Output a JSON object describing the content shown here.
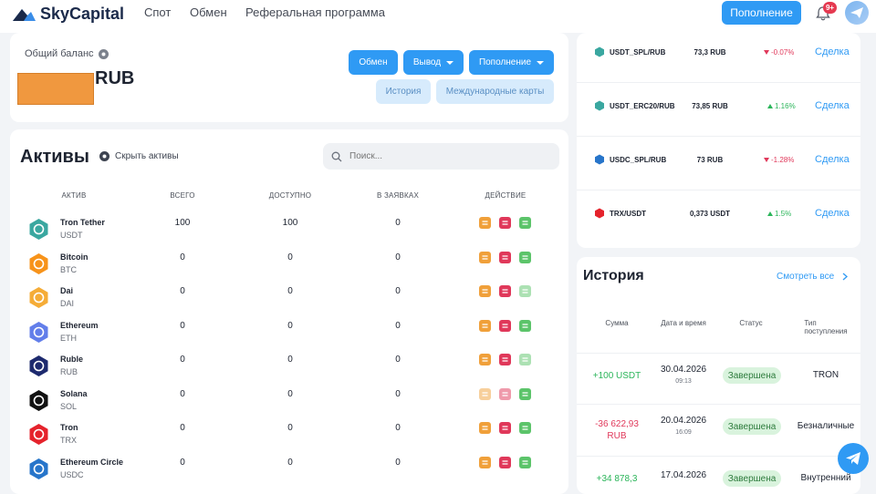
{
  "header": {
    "brand": "SkyCapital",
    "nav": [
      "Спот",
      "Обмен",
      "Реферальная программа"
    ],
    "topup_label": "Пополнение",
    "notifications_badge": "9+"
  },
  "balance": {
    "label": "Общий баланс",
    "currency": "RUB",
    "buttons": {
      "exchange": "Обмен",
      "withdraw": "Вывод",
      "topup": "Пополнение",
      "history": "История",
      "cards": "Международные карты"
    }
  },
  "assets": {
    "title": "Активы",
    "hide_label": "Скрыть активы",
    "search_placeholder": "Поиск...",
    "columns": [
      "АКТИВ",
      "ВСЕГО",
      "ДОСТУПНО",
      "В ЗАЯВКАХ",
      "ДЕЙСТВИЕ"
    ],
    "rows": [
      {
        "name": "Tron Tether",
        "ticker": "USDT",
        "total": "100",
        "available": "100",
        "orders": "0",
        "icon": "tether-icon",
        "color": "#3aa7a0"
      },
      {
        "name": "Bitcoin",
        "ticker": "BTC",
        "total": "0",
        "available": "0",
        "orders": "0",
        "icon": "bitcoin-icon",
        "color": "#f7931a"
      },
      {
        "name": "Dai",
        "ticker": "DAI",
        "total": "0",
        "available": "0",
        "orders": "0",
        "icon": "dai-icon",
        "color": "#f5ac37"
      },
      {
        "name": "Ethereum",
        "ticker": "ETH",
        "total": "0",
        "available": "0",
        "orders": "0",
        "icon": "ethereum-icon",
        "color": "#627eea"
      },
      {
        "name": "Ruble",
        "ticker": "RUB",
        "total": "0",
        "available": "0",
        "orders": "0",
        "icon": "ruble-icon",
        "color": "#1d2a6e"
      },
      {
        "name": "Solana",
        "ticker": "SOL",
        "total": "0",
        "available": "0",
        "orders": "0",
        "icon": "solana-icon",
        "color": "#111111"
      },
      {
        "name": "Tron",
        "ticker": "TRX",
        "total": "0",
        "available": "0",
        "orders": "0",
        "icon": "tron-icon",
        "color": "#e5232c"
      },
      {
        "name": "Ethereum Circle",
        "ticker": "USDC",
        "total": "0",
        "available": "0",
        "orders": "0",
        "icon": "usdc-icon",
        "color": "#2775ca"
      }
    ]
  },
  "pairs": [
    {
      "name": "USDT_SPL/RUB",
      "price": "73,3 RUB",
      "change": "-0.07%",
      "dir": "down",
      "deal": "Сделка",
      "icon_color": "#3aa7a0"
    },
    {
      "name": "USDT_ERC20/RUB",
      "price": "73,85 RUB",
      "change": "1.16%",
      "dir": "up",
      "deal": "Сделка",
      "icon_color": "#3aa7a0"
    },
    {
      "name": "USDC_SPL/RUB",
      "price": "73 RUB",
      "change": "-1.28%",
      "dir": "down",
      "deal": "Сделка",
      "icon_color": "#2775ca"
    },
    {
      "name": "TRX/USDT",
      "price": "0,373 USDT",
      "change": "1.5%",
      "dir": "up",
      "deal": "Сделка",
      "icon_color": "#e5232c"
    }
  ],
  "history": {
    "title": "История",
    "see_all": "Смотреть все",
    "columns": [
      "Сумма",
      "Дата и время",
      "Статус",
      "Тип поступления"
    ],
    "rows": [
      {
        "amount": "+100 USDT",
        "amount2": "",
        "date": "30.04.2026",
        "time": "09:13",
        "status": "Завершена",
        "type": "TRON",
        "sign": "plus"
      },
      {
        "amount": "-36 622,93",
        "amount2": "RUB",
        "date": "20.04.2026",
        "time": "16:09",
        "status": "Завершена",
        "type": "Безналичные",
        "sign": "minus"
      },
      {
        "amount": "+34 878,3",
        "amount2": "",
        "date": "17.04.2026",
        "time": "",
        "status": "Завершена",
        "type": "Внутренний",
        "sign": "plus"
      }
    ]
  },
  "colors": {
    "accent": "#2f9af4",
    "up": "#2bb55a",
    "down": "#e0385a",
    "mask": "#f0983f"
  }
}
